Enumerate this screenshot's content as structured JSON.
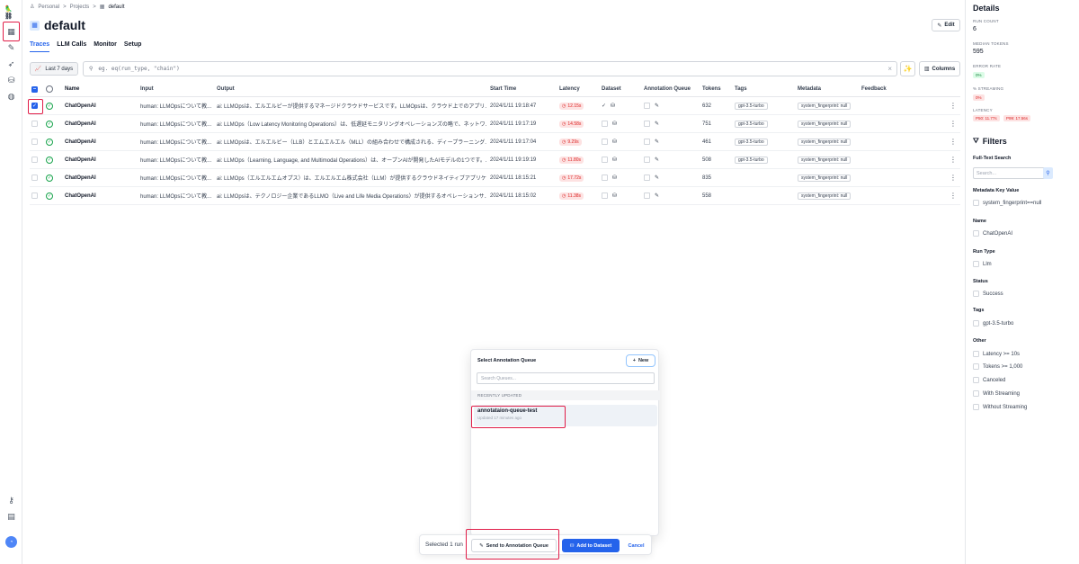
{
  "rail": {
    "logo": "🦜⛓"
  },
  "breadcrumb": {
    "personal": "Personal",
    "sep": ">",
    "projects": "Projects",
    "current": "default"
  },
  "header": {
    "title": "default",
    "edit_label": "Edit"
  },
  "tabs": [
    {
      "label": "Traces"
    },
    {
      "label": "LLM Calls"
    },
    {
      "label": "Monitor"
    },
    {
      "label": "Setup"
    }
  ],
  "toolbar": {
    "range_label": "Last 7 days",
    "query_placeholder": "eg. eq(run_type, \"chain\")",
    "columns_label": "Columns"
  },
  "table": {
    "headers": {
      "name": "Name",
      "input": "Input",
      "output": "Output",
      "start_time": "Start Time",
      "latency": "Latency",
      "dataset": "Dataset",
      "annotation_queue": "Annotation Queue",
      "tokens": "Tokens",
      "tags": "Tags",
      "metadata": "Metadata",
      "feedback": "Feedback"
    },
    "rows": [
      {
        "name": "ChatOpenAI",
        "input": "human: LLMOpsについて教...",
        "output": "ai: LLMOpsは、エルエルピーが提供するマネージドクラウドサービスです。LLMOpsは、クラウド上でのアプリ...",
        "start_time": "2024/1/11 19:18:47",
        "latency": "12.15s",
        "tokens": "632",
        "tag": "gpt-3.5-turbo",
        "meta": "system_fingerprint: null"
      },
      {
        "name": "ChatOpenAI",
        "input": "human: LLMOpsについて教...",
        "output": "ai: LLMOps（Low Latency Monitoring Operations）は、低遅延モニタリングオペレーションズの略で、ネットワ...",
        "start_time": "2024/1/11 19:17:19",
        "latency": "14.58s",
        "tokens": "751",
        "tag": "gpt-3.5-turbo",
        "meta": "system_fingerprint: null"
      },
      {
        "name": "ChatOpenAI",
        "input": "human: LLMOpsについて教...",
        "output": "ai: LLMOpsは、エルエルビー（LLB）とエムエルエル（MLL）の組み合わせで構成される、ディープラーニング...",
        "start_time": "2024/1/11 19:17:04",
        "latency": "9.29s",
        "tokens": "461",
        "tag": "gpt-3.5-turbo",
        "meta": "system_fingerprint: null"
      },
      {
        "name": "ChatOpenAI",
        "input": "human: LLMOpsについて教...",
        "output": "ai: LLMOps（Learning, Language, and Multimodal Operations）は、オープンAIが開発したAIモデルの1つです。...",
        "start_time": "2024/1/11 19:19:19",
        "latency": "11.80s",
        "tokens": "508",
        "tag": "gpt-3.5-turbo",
        "meta": "system_fingerprint: null"
      },
      {
        "name": "ChatOpenAI",
        "input": "human: LLMOpsについて教...",
        "output": "ai: LLMOps（エルエルエムオプス）は、エルエルエム株式会社（LLM）が提供するクラウドネイティブアプリケ...",
        "start_time": "2024/1/11 18:15:21",
        "latency": "17.72s",
        "tokens": "835",
        "tag": "",
        "meta": "system_fingerprint: null"
      },
      {
        "name": "ChatOpenAI",
        "input": "human: LLMOpsについて教...",
        "output": "ai: LLMOpsは、テクノロジー企業であるLLMO（Live and Life Media Operations）が提供するオペレーションサ...",
        "start_time": "2024/1/11 18:15:02",
        "latency": "11.38s",
        "tokens": "558",
        "tag": "",
        "meta": "system_fingerprint: null"
      }
    ]
  },
  "details": {
    "title": "Details",
    "run_count_label": "RUN COUNT",
    "run_count": "6",
    "median_tokens_label": "MEDIAN TOKENS",
    "median_tokens": "595",
    "error_rate_label": "ERROR RATE",
    "error_rate": "0%",
    "streaming_label": "% STREAMING",
    "streaming": "0%",
    "latency_label": "LATENCY",
    "p50": "P50: 11.77s",
    "p99": "P99: 17.56s"
  },
  "filters": {
    "title": "Filters",
    "fulltext_label": "Full-Text Search",
    "search_placeholder": "Search...",
    "metadata_label": "Metadata Key Value",
    "metadata_opt": "system_fingerprint==null",
    "name_label": "Name",
    "name_opt": "ChatOpenAI",
    "runtype_label": "Run Type",
    "runtype_opt": "Llm",
    "status_label": "Status",
    "status_opt": "Success",
    "tags_label": "Tags",
    "tags_opt": "gpt-3.5-turbo",
    "other_label": "Other",
    "other_opts": [
      "Latency >= 10s",
      "Tokens >= 1,000",
      "Canceled",
      "With Streaming",
      "Without Streaming"
    ]
  },
  "popover": {
    "title": "Select Annotation Queue",
    "new_label": "New",
    "search_placeholder": "Search Queues...",
    "section": "RECENTLY UPDATED",
    "queue_name": "annotataion-queue-test",
    "queue_sub": "Updated 17 minutes ago"
  },
  "actionbar": {
    "selected": "Selected 1 run",
    "send_label": "Send to Annotation Queue",
    "add_label": "Add to Dataset",
    "cancel_label": "Cancel"
  }
}
